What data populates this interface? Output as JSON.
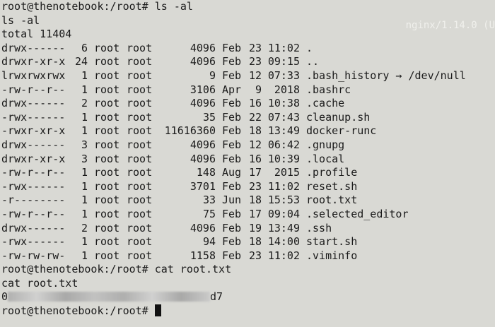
{
  "prompt_text": "root@thenotebook:/root# ",
  "cmd_ls": "ls -al",
  "echo_ls": "ls -al",
  "total": "total 11404",
  "ghost_text": "nginx/1.14.0 (U",
  "listing": [
    {
      "perm": "drwx------",
      "links": "6",
      "owner": "root",
      "group": "root",
      "size": "4096",
      "month": "Feb",
      "day": "23",
      "time": "11:02",
      "name": ".",
      "target": ""
    },
    {
      "perm": "drwxr-xr-x",
      "links": "24",
      "owner": "root",
      "group": "root",
      "size": "4096",
      "month": "Feb",
      "day": "23",
      "time": "09:15",
      "name": "..",
      "target": ""
    },
    {
      "perm": "lrwxrwxrwx",
      "links": "1",
      "owner": "root",
      "group": "root",
      "size": "9",
      "month": "Feb",
      "day": "12",
      "time": "07:33",
      "name": ".bash_history → /dev/null",
      "target": ""
    },
    {
      "perm": "-rw-r--r--",
      "links": "1",
      "owner": "root",
      "group": "root",
      "size": "3106",
      "month": "Apr",
      "day": "9",
      "time": "2018",
      "name": ".bashrc",
      "target": ""
    },
    {
      "perm": "drwx------",
      "links": "2",
      "owner": "root",
      "group": "root",
      "size": "4096",
      "month": "Feb",
      "day": "16",
      "time": "10:38",
      "name": ".cache",
      "target": ""
    },
    {
      "perm": "-rwx------",
      "links": "1",
      "owner": "root",
      "group": "root",
      "size": "35",
      "month": "Feb",
      "day": "22",
      "time": "07:43",
      "name": "cleanup.sh",
      "target": ""
    },
    {
      "perm": "-rwxr-xr-x",
      "links": "1",
      "owner": "root",
      "group": "root",
      "size": "11616360",
      "month": "Feb",
      "day": "18",
      "time": "13:49",
      "name": "docker-runc",
      "target": ""
    },
    {
      "perm": "drwx------",
      "links": "3",
      "owner": "root",
      "group": "root",
      "size": "4096",
      "month": "Feb",
      "day": "12",
      "time": "06:42",
      "name": ".gnupg",
      "target": ""
    },
    {
      "perm": "drwxr-xr-x",
      "links": "3",
      "owner": "root",
      "group": "root",
      "size": "4096",
      "month": "Feb",
      "day": "16",
      "time": "10:39",
      "name": ".local",
      "target": ""
    },
    {
      "perm": "-rw-r--r--",
      "links": "1",
      "owner": "root",
      "group": "root",
      "size": "148",
      "month": "Aug",
      "day": "17",
      "time": "2015",
      "name": ".profile",
      "target": ""
    },
    {
      "perm": "-rwx------",
      "links": "1",
      "owner": "root",
      "group": "root",
      "size": "3701",
      "month": "Feb",
      "day": "23",
      "time": "11:02",
      "name": "reset.sh",
      "target": ""
    },
    {
      "perm": "-r--------",
      "links": "1",
      "owner": "root",
      "group": "root",
      "size": "33",
      "month": "Jun",
      "day": "18",
      "time": "15:53",
      "name": "root.txt",
      "target": ""
    },
    {
      "perm": "-rw-r--r--",
      "links": "1",
      "owner": "root",
      "group": "root",
      "size": "75",
      "month": "Feb",
      "day": "17",
      "time": "09:04",
      "name": ".selected_editor",
      "target": ""
    },
    {
      "perm": "drwx------",
      "links": "2",
      "owner": "root",
      "group": "root",
      "size": "4096",
      "month": "Feb",
      "day": "19",
      "time": "13:49",
      "name": ".ssh",
      "target": ""
    },
    {
      "perm": "-rwx------",
      "links": "1",
      "owner": "root",
      "group": "root",
      "size": "94",
      "month": "Feb",
      "day": "18",
      "time": "14:00",
      "name": "start.sh",
      "target": ""
    },
    {
      "perm": "-rw-rw-rw-",
      "links": "1",
      "owner": "root",
      "group": "root",
      "size": "1158",
      "month": "Feb",
      "day": "23",
      "time": "11:02",
      "name": ".viminfo",
      "target": ""
    }
  ],
  "cmd_cat": "cat root.txt",
  "echo_cat": "cat root.txt",
  "flag_start": "0",
  "flag_end": "d7",
  "final_prompt": "root@thenotebook:/root# "
}
